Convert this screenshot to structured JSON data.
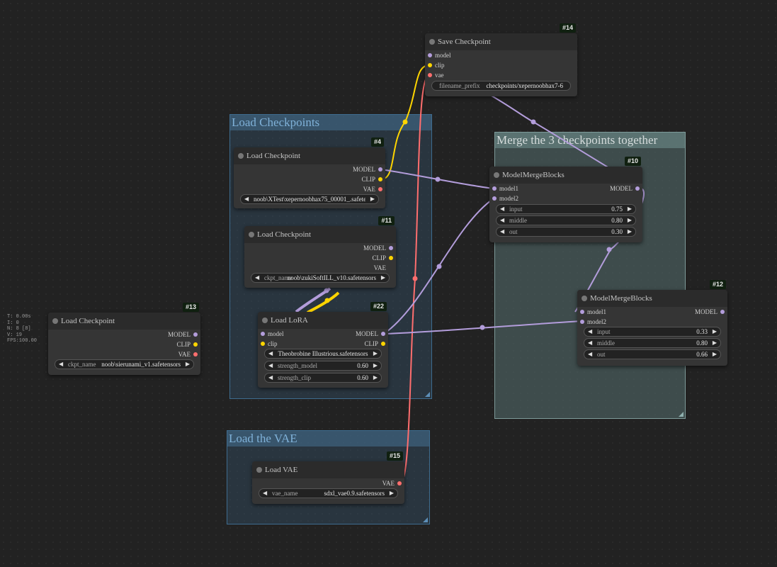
{
  "colors": {
    "model": "#b39ddb",
    "clip": "#ffd500",
    "vae": "#ff6e6e",
    "background": "#222222"
  },
  "stats": [
    "T: 0.00s",
    "I: 0",
    "N: 8 [8]",
    "V: 19",
    "FPS:100.00"
  ],
  "groups": {
    "load_checkpoints": "Load Checkpoints",
    "merge": "Merge the 3 checkpoints together",
    "load_vae": "Load the VAE"
  },
  "nodes": {
    "n14": {
      "id": "#14",
      "title": "Save Checkpoint",
      "inputs": [
        "model",
        "clip",
        "vae"
      ],
      "widget_label": "filename_prefix",
      "widget_value": "checkpoints/xepernoobhax7-6"
    },
    "n4": {
      "id": "#4",
      "title": "Load Checkpoint",
      "outputs": [
        "MODEL",
        "CLIP",
        "VAE"
      ],
      "widget_value": "noob\\XTest\\xepernoobhax75_00001_.safeten ..."
    },
    "n11": {
      "id": "#11",
      "title": "Load Checkpoint",
      "outputs": [
        "MODEL",
        "CLIP",
        "VAE"
      ],
      "widget_label": "ckpt_name",
      "widget_value": "noob\\zukiSoftILL_v10.safetensors"
    },
    "n22": {
      "id": "#22",
      "title": "Load LoRA",
      "inputs": [
        "model",
        "clip"
      ],
      "outputs": [
        "MODEL",
        "CLIP"
      ],
      "lora_name": "Theobrobine Illustrious.safetensors",
      "strength_model_label": "strength_model",
      "strength_model": "0.60",
      "strength_clip_label": "strength_clip",
      "strength_clip": "0.60"
    },
    "n13": {
      "id": "#13",
      "title": "Load Checkpoint",
      "outputs": [
        "MODEL",
        "CLIP",
        "VAE"
      ],
      "widget_label": "ckpt_name",
      "widget_value": "noob\\sierunami_v1.safetensors"
    },
    "n10": {
      "id": "#10",
      "title": "ModelMergeBlocks",
      "inputs": [
        "model1",
        "model2"
      ],
      "outputs": [
        "MODEL"
      ],
      "widgets": [
        {
          "label": "input",
          "value": "0.75"
        },
        {
          "label": "middle",
          "value": "0.80"
        },
        {
          "label": "out",
          "value": "0.30"
        }
      ]
    },
    "n12": {
      "id": "#12",
      "title": "ModelMergeBlocks",
      "inputs": [
        "model1",
        "model2"
      ],
      "outputs": [
        "MODEL"
      ],
      "widgets": [
        {
          "label": "input",
          "value": "0.33"
        },
        {
          "label": "middle",
          "value": "0.80"
        },
        {
          "label": "out",
          "value": "0.66"
        }
      ]
    },
    "n15": {
      "id": "#15",
      "title": "Load VAE",
      "outputs": [
        "VAE"
      ],
      "widget_label": "vae_name",
      "widget_value": "sdxl_vae0.9.safetensors"
    }
  }
}
